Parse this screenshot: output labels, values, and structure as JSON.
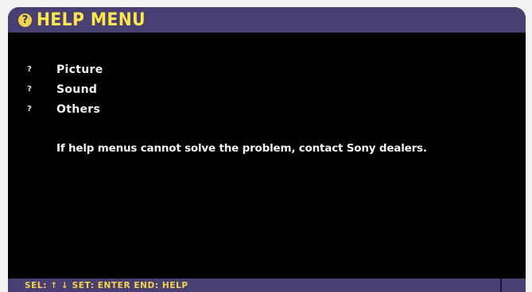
{
  "header": {
    "title": "HELP MENU",
    "icon": "help-icon",
    "icon_glyph": "?"
  },
  "menu": {
    "marker": "?",
    "items": [
      {
        "label": "Picture"
      },
      {
        "label": "Sound"
      },
      {
        "label": "Others"
      }
    ]
  },
  "message": "If help menus cannot solve the problem, contact Sony dealers.",
  "footer": {
    "hint": "SEL: ↑ ↓ SET: ENTER END: HELP"
  },
  "colors": {
    "background": "#000000",
    "bar": "#4a3f73",
    "title": "#ffe84a",
    "text": "#f2f2f2"
  }
}
